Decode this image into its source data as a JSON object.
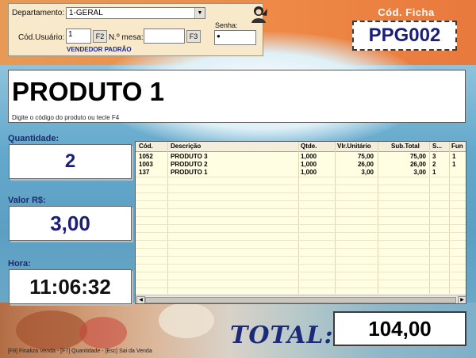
{
  "header": {
    "department_label": "Departamento:",
    "department_value": "1-GERAL",
    "user_label": "Cód.Usuário:",
    "user_value": "1",
    "user_key": "F2",
    "table_label": "N.º mesa:",
    "table_value": "",
    "table_key": "F3",
    "password_label": "Senha:",
    "password_value": "",
    "vendor_name": "VENDEDOR PADRÃO"
  },
  "ficha": {
    "title": "Cód. Ficha",
    "value": "PPG002"
  },
  "product": {
    "name": "PRODUTO 1",
    "hint": "Digite o código do produto ou tecle F4"
  },
  "quantity": {
    "label": "Quantidade:",
    "value": "2"
  },
  "price": {
    "label": "Valor R$:",
    "value": "3,00"
  },
  "time": {
    "label": "Hora:",
    "value": "11:06:32"
  },
  "grid": {
    "columns": [
      "Cód.",
      "Descrição",
      "Qtde.",
      "Vlr.Unitário",
      "Sub.Total",
      "S...",
      "Fun"
    ],
    "rows": [
      [
        "1052",
        "PRODUTO 3",
        "1,000",
        "75,00",
        "75,00",
        "3",
        "1"
      ],
      [
        "1003",
        "PRODUTO 2",
        "1,000",
        "26,00",
        "26,00",
        "2",
        "1"
      ],
      [
        "137",
        "PRODUTO 1",
        "1,000",
        "3,00",
        "3,00",
        "1",
        ""
      ]
    ]
  },
  "total": {
    "label": "TOTAL:",
    "value": "104,00"
  },
  "footer": {
    "hint": "[F8] Finaliza Venda - [F7] Quantidade - [Esc] Sai da Venda"
  },
  "colors": {
    "accent_orange": "#e8793c",
    "header_panel": "#f7e9c9",
    "label_blue": "#1f2a6e",
    "value_blue": "#1b1f7a",
    "grid_background": "#fffde2"
  }
}
